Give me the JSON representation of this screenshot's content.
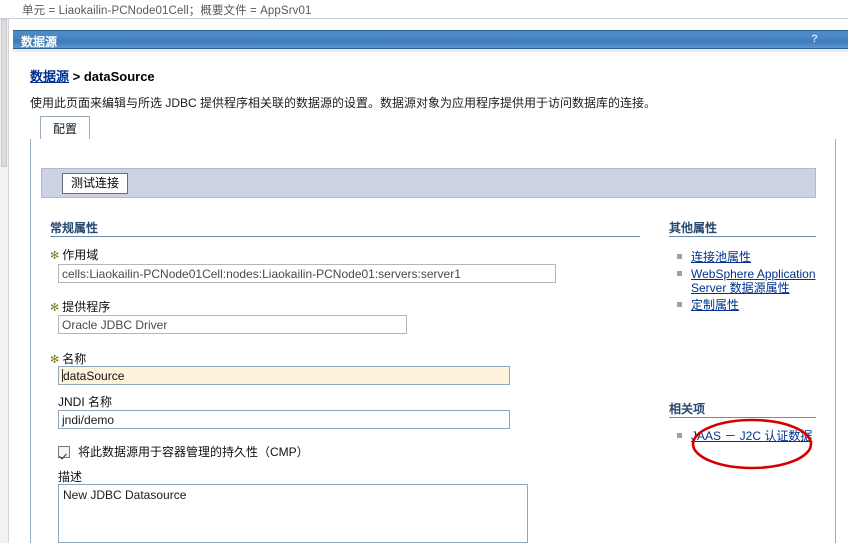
{
  "window": {
    "context_bar": "单元 = Liaokailin-PCNode01Cell；概要文件 = AppSrv01",
    "page_title": "数据源",
    "help_icon": "?"
  },
  "breadcrumb": {
    "root_link": "数据源",
    "separator": ">",
    "current": "dataSource"
  },
  "intro_text": "使用此页面来编辑与所选 JDBC 提供程序相关联的数据源的设置。数据源对象为应用程序提供用于访问数据库的连接。",
  "tabs": [
    {
      "label": "配置",
      "active": true
    }
  ],
  "toolbar": {
    "test_connection_label": "测试连接"
  },
  "general_properties": {
    "heading": "常规属性",
    "fields": [
      {
        "label": "作用域",
        "required": true,
        "value": "cells:Liaokailin-PCNode01Cell:nodes:Liaokailin-PCNode01:servers:server1",
        "state": "readonly"
      },
      {
        "label": "提供程序",
        "required": true,
        "value": "Oracle JDBC Driver",
        "state": "readonly"
      },
      {
        "label": "名称",
        "required": true,
        "value": "dataSource",
        "state": "focused"
      },
      {
        "label": "JNDI 名称",
        "required": false,
        "value": "jndi/demo",
        "state": "normal"
      }
    ],
    "checkbox": {
      "label": "将此数据源用于容器管理的持久性（CMP）",
      "checked": true
    },
    "description": {
      "label": "描述",
      "value": "New JDBC Datasource"
    }
  },
  "right_rail": {
    "additional": {
      "heading": "其他属性",
      "links": [
        "连接池属性",
        "WebSphere Application Server 数据源属性",
        "定制属性"
      ]
    },
    "related": {
      "heading": "相关项",
      "links": [
        "JAAS － J2C 认证数据"
      ]
    }
  },
  "annotation": {
    "shape": "ellipse",
    "color": "#d40000",
    "target": "JAAS － J2C 认证数据"
  },
  "colors": {
    "titlebar_blue": "#4a86c4",
    "link_blue": "#00338d",
    "section_heading": "#27486d",
    "command_bar": "#ccd2e2",
    "focused_field": "#fcf3da",
    "annotation_red": "#d40000"
  }
}
